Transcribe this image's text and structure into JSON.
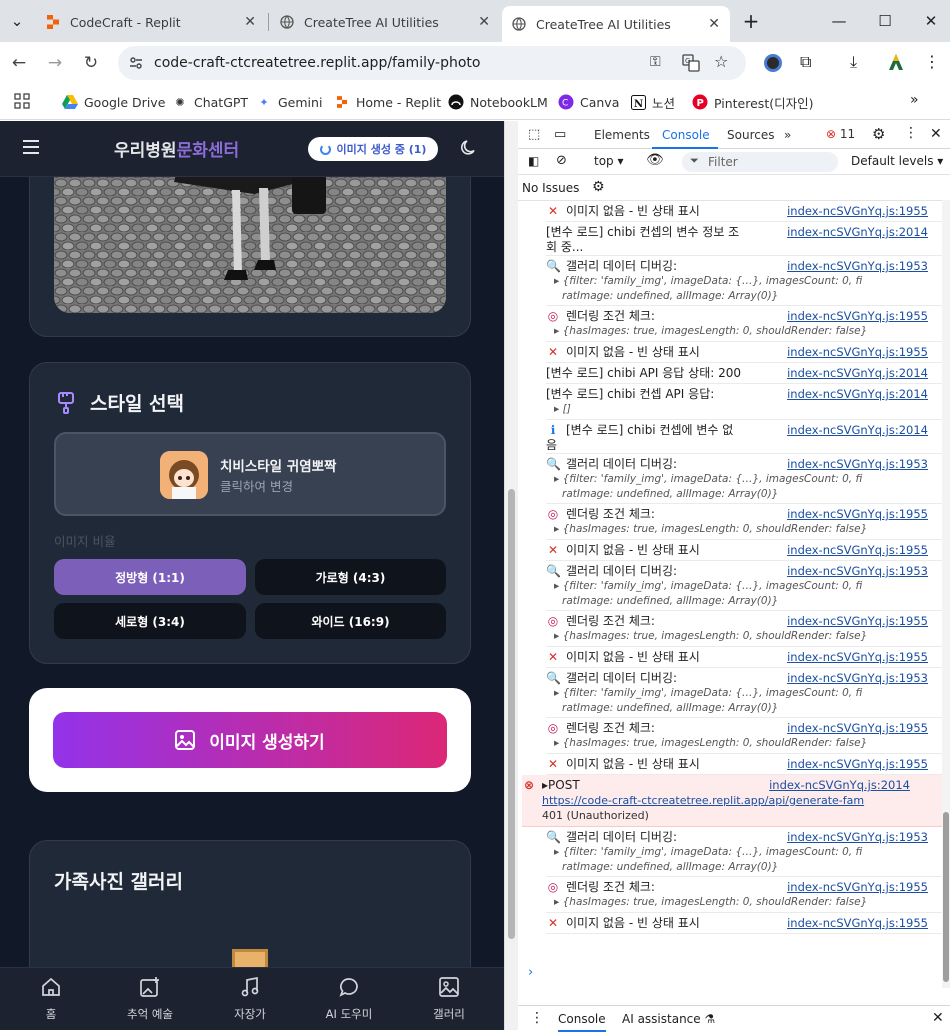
{
  "tabs": [
    {
      "title": "CodeCraft - Replit"
    },
    {
      "title": "CreateTree AI Utilities"
    },
    {
      "title": "CreateTree AI Utilities"
    }
  ],
  "url": "code-craft-ctcreatetree.replit.app/family-photo",
  "bookmarks": [
    "Google Drive",
    "ChatGPT",
    "Gemini",
    "Home - Replit",
    "NotebookLM",
    "Canva",
    "노션",
    "Pinterest(디자인)"
  ],
  "app": {
    "title_a": "우리병원",
    "title_b": "문화센터",
    "status": "이미지 생성 중 (1)",
    "style_heading": "스타일 선택",
    "style_name": "치비스타일 귀염뽀짝",
    "style_hint": "클릭하여 변경",
    "ratio_label": "이미지 비율",
    "ratios": [
      "정방형 (1:1)",
      "가로형 (4:3)",
      "세로형 (3:4)",
      "와이드 (16:9)"
    ],
    "generate": "이미지 생성하기",
    "gallery": "가족사진 갤러리",
    "nav": [
      "홈",
      "추억 예술",
      "자장가",
      "AI 도우미",
      "갤러리"
    ]
  },
  "devtools": {
    "tabs": [
      "Elements",
      "Console",
      "Sources"
    ],
    "error_count": "11",
    "context": "top",
    "filter": "Filter",
    "levels": "Default levels",
    "issues": "No Issues",
    "bottom_tabs": [
      "Console",
      "AI assistance"
    ],
    "logs": [
      {
        "type": "x",
        "msg": "이미지 없음 - 빈 상태 표시",
        "src": "index-ncSVGnYq.js:1955"
      },
      {
        "type": "plain",
        "msg": "[변수 로드] chibi 컨셉의 변수 정보 조",
        "msg2": "회 중...",
        "src": "index-ncSVGnYq.js:2014"
      },
      {
        "type": "search",
        "msg": "갤러리 데이터 디버깅:",
        "src": "index-ncSVGnYq.js:1953",
        "sub": "{filter: 'family_img', imageData: {…}, imagesCount: 0, fi",
        "sub2": "ratImage: undefined, allImage: Array(0)}"
      },
      {
        "type": "target",
        "msg": "렌더링 조건 체크:",
        "src": "index-ncSVGnYq.js:1955",
        "sub": "{hasImages: true, imagesLength: 0, shouldRender: false}"
      },
      {
        "type": "x",
        "msg": "이미지 없음 - 빈 상태 표시",
        "src": "index-ncSVGnYq.js:1955"
      },
      {
        "type": "plain",
        "msg": "[변수 로드] chibi API 응답 상태: 200",
        "src": "index-ncSVGnYq.js:2014"
      },
      {
        "type": "plain",
        "msg": "[변수 로드] chibi 컨셉 API 응답:",
        "src": "index-ncSVGnYq.js:2014",
        "sub": "[]"
      },
      {
        "type": "info",
        "msg": "[변수 로드] chibi 컨셉에 변수 없",
        "msg2": "음",
        "src": "index-ncSVGnYq.js:2014"
      },
      {
        "type": "search",
        "msg": "갤러리 데이터 디버깅:",
        "src": "index-ncSVGnYq.js:1953",
        "sub": "{filter: 'family_img', imageData: {…}, imagesCount: 0, fi",
        "sub2": "ratImage: undefined, allImage: Array(0)}"
      },
      {
        "type": "target",
        "msg": "렌더링 조건 체크:",
        "src": "index-ncSVGnYq.js:1955",
        "sub": "{hasImages: true, imagesLength: 0, shouldRender: false}"
      },
      {
        "type": "x",
        "msg": "이미지 없음 - 빈 상태 표시",
        "src": "index-ncSVGnYq.js:1955"
      },
      {
        "type": "search",
        "msg": "갤러리 데이터 디버깅:",
        "src": "index-ncSVGnYq.js:1953",
        "sub": "{filter: 'family_img', imageData: {…}, imagesCount: 0, fi",
        "sub2": "ratImage: undefined, allImage: Array(0)}"
      },
      {
        "type": "target",
        "msg": "렌더링 조건 체크:",
        "src": "index-ncSVGnYq.js:1955",
        "sub": "{hasImages: true, imagesLength: 0, shouldRender: false}"
      },
      {
        "type": "x",
        "msg": "이미지 없음 - 빈 상태 표시",
        "src": "index-ncSVGnYq.js:1955"
      },
      {
        "type": "search",
        "msg": "갤러리 데이터 디버깅:",
        "src": "index-ncSVGnYq.js:1953",
        "sub": "{filter: 'family_img', imageData: {…}, imagesCount: 0, fi",
        "sub2": "ratImage: undefined, allImage: Array(0)}"
      },
      {
        "type": "target",
        "msg": "렌더링 조건 체크:",
        "src": "index-ncSVGnYq.js:1955",
        "sub": "{hasImages: true, imagesLength: 0, shouldRender: false}"
      },
      {
        "type": "x",
        "msg": "이미지 없음 - 빈 상태 표시",
        "src": "index-ncSVGnYq.js:1955"
      },
      {
        "type": "error",
        "msg": "POST",
        "src": "index-ncSVGnYq.js:2014",
        "sub": "https://code-craft-ctcreatetree.replit.app/api/generate-fam",
        "sub2": "401 (Unauthorized)"
      },
      {
        "type": "search",
        "msg": "갤러리 데이터 디버깅:",
        "src": "index-ncSVGnYq.js:1953",
        "sub": "{filter: 'family_img', imageData: {…}, imagesCount: 0, fi",
        "sub2": "ratImage: undefined, allImage: Array(0)}"
      },
      {
        "type": "target",
        "msg": "렌더링 조건 체크:",
        "src": "index-ncSVGnYq.js:1955",
        "sub": "{hasImages: true, imagesLength: 0, shouldRender: false}"
      },
      {
        "type": "x",
        "msg": "이미지 없음 - 빈 상태 표시",
        "src": "index-ncSVGnYq.js:1955"
      }
    ]
  }
}
